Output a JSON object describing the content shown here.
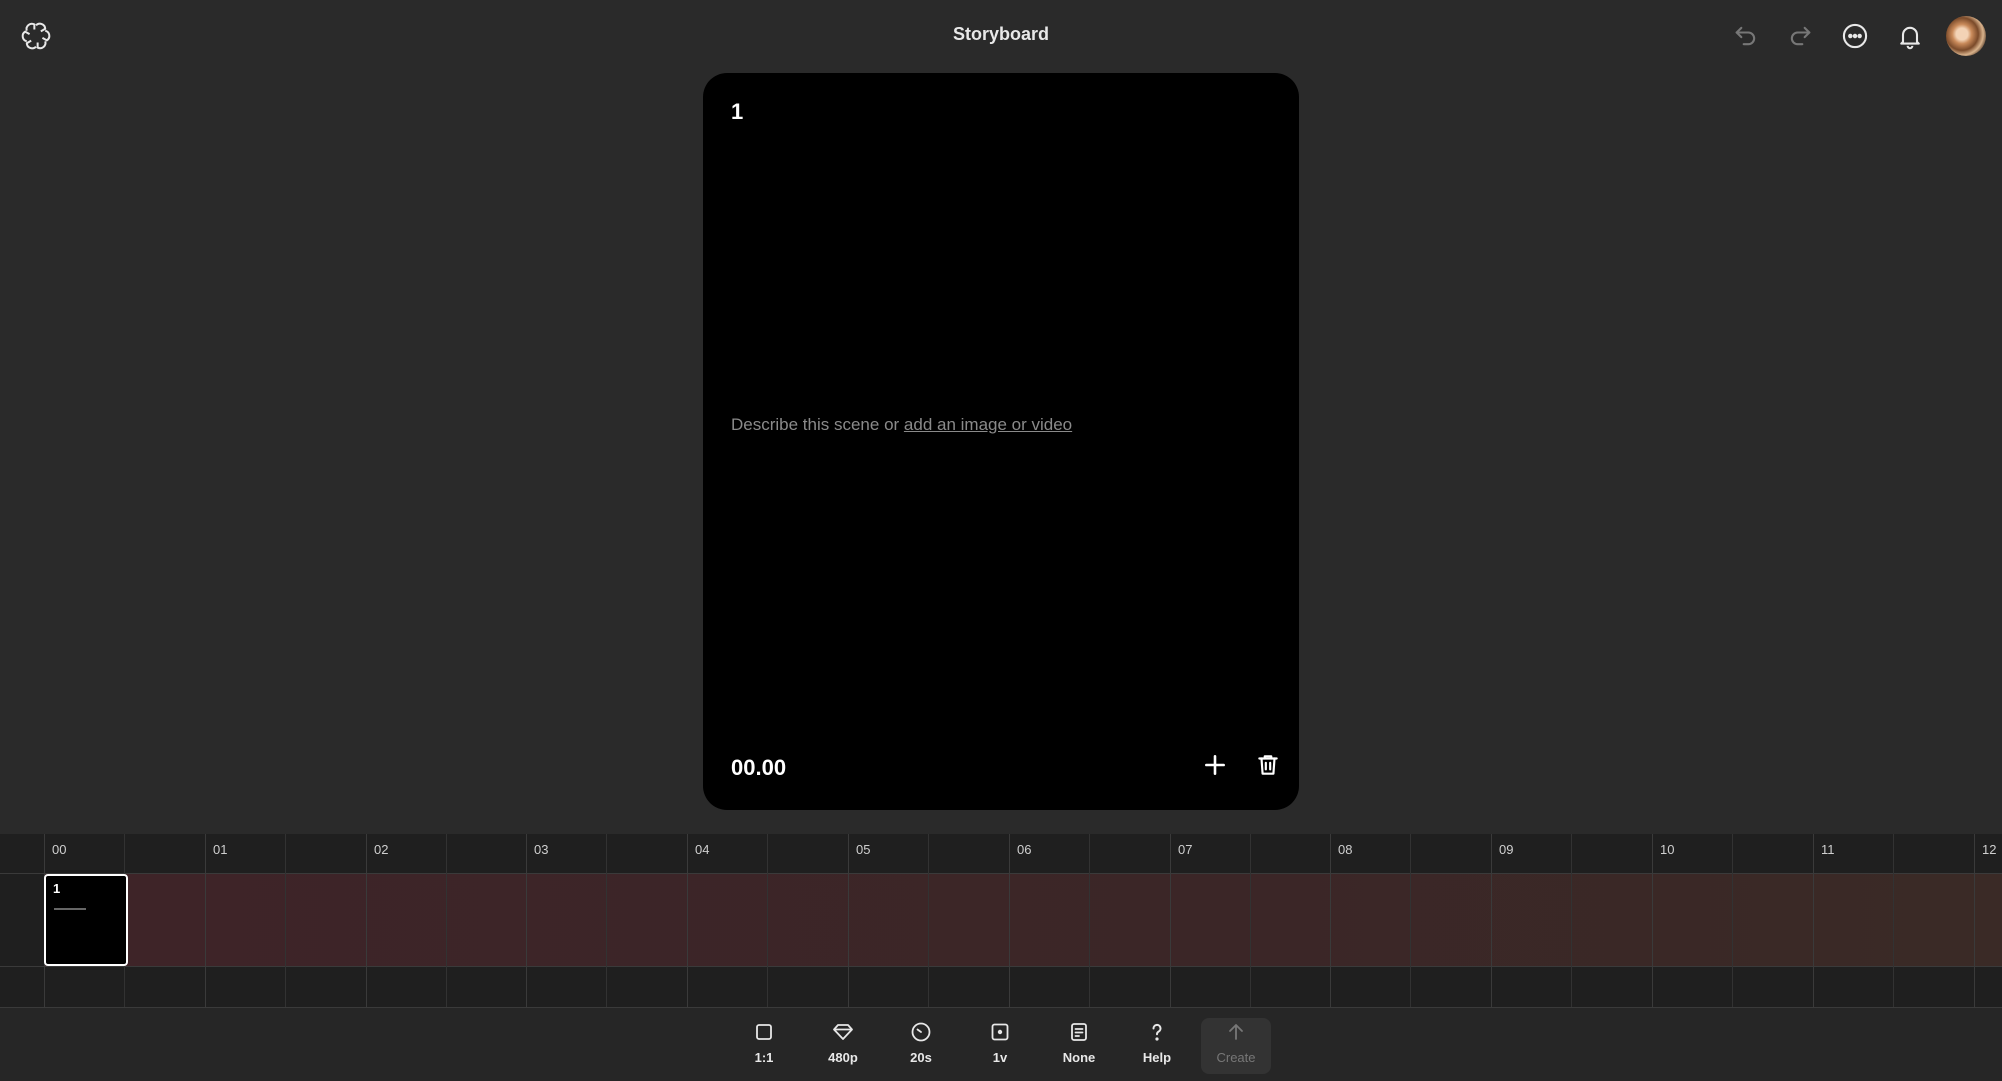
{
  "header": {
    "title": "Storyboard",
    "icons": [
      "openai-logo-icon",
      "undo-icon",
      "redo-icon",
      "more-icon",
      "bell-icon",
      "avatar"
    ]
  },
  "card": {
    "scene_number": "1",
    "prompt_text": "Describe this scene or ",
    "prompt_link": "add an image or video",
    "time": "00.00"
  },
  "timeline": {
    "ticks": [
      "00",
      "01",
      "02",
      "03",
      "04",
      "05",
      "06",
      "07",
      "08",
      "09",
      "10",
      "11",
      "12"
    ],
    "clip_number": "1"
  },
  "toolbar": {
    "aspect_label": "1:1",
    "resolution_label": "480p",
    "duration_label": "20s",
    "variations_label": "1v",
    "preset_label": "None",
    "help_label": "Help",
    "create_label": "Create"
  },
  "colors": {
    "background": "#2a2a2a",
    "card": "#000000",
    "track": "#3e2428"
  }
}
